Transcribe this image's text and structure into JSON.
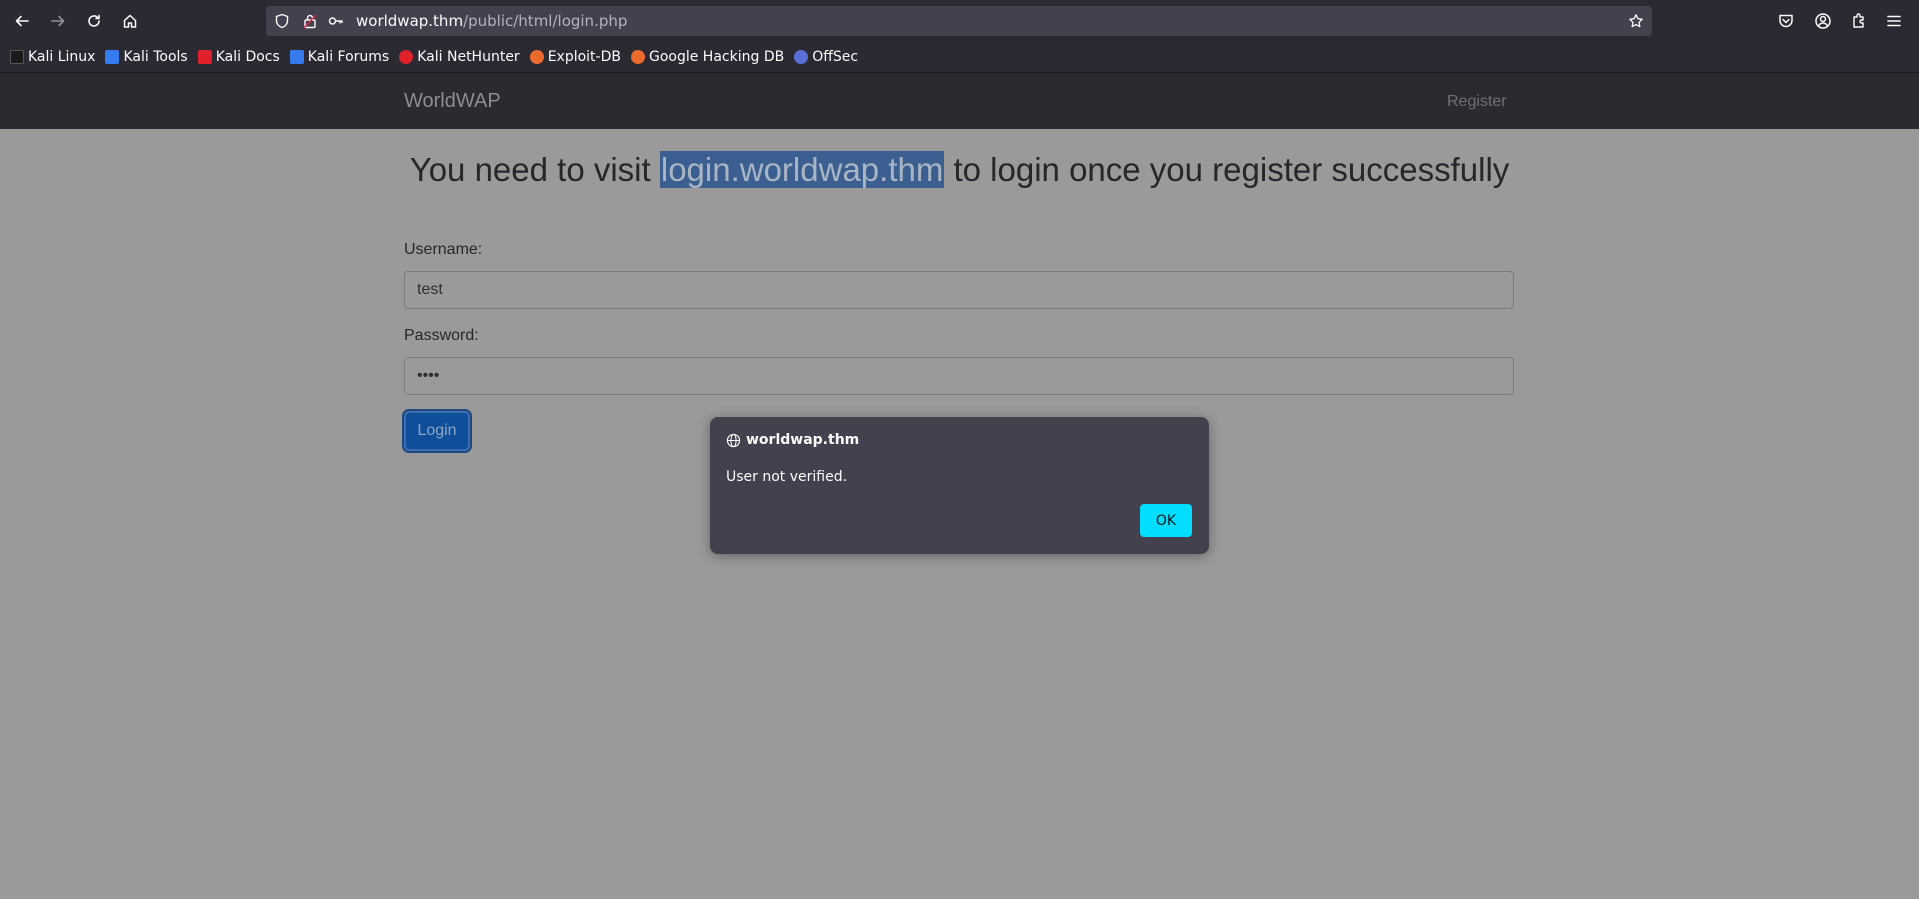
{
  "browser": {
    "url_host": "worldwap.thm",
    "url_path": "/public/html/login.php",
    "bookmarks": [
      {
        "label": "Kali Linux",
        "color": "#1a1a1a"
      },
      {
        "label": "Kali Tools",
        "color": "#367bf0"
      },
      {
        "label": "Kali Docs",
        "color": "#e0202a"
      },
      {
        "label": "Kali Forums",
        "color": "#367bf0"
      },
      {
        "label": "Kali NetHunter",
        "color": "#e0202a"
      },
      {
        "label": "Exploit-DB",
        "color": "#ec6a2d"
      },
      {
        "label": "Google Hacking DB",
        "color": "#ec6a2d"
      },
      {
        "label": "OffSec",
        "color": "#5a6fd6"
      }
    ]
  },
  "site": {
    "brand": "WorldWAP",
    "register_link": "Register"
  },
  "main": {
    "headline_before": "You need to visit ",
    "headline_highlight": "login.worldwap.thm",
    "headline_after": " to login once you register successfully",
    "username_label": "Username:",
    "username_value": "test",
    "password_label": "Password:",
    "password_value": "test",
    "login_button": "Login"
  },
  "dialog": {
    "origin": "worldwap.thm",
    "message": "User not verified.",
    "ok_button": "OK"
  }
}
